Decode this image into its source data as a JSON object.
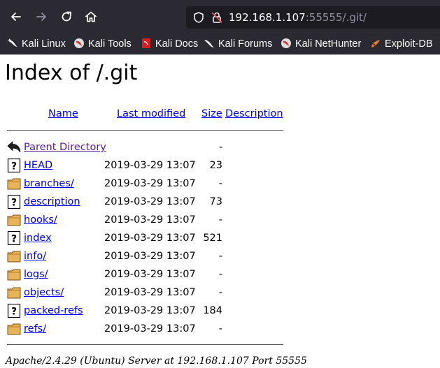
{
  "browser": {
    "url_host": "192.168.1.107",
    "url_rest": ":55555/.git/",
    "back_icon": "arrow-left-icon",
    "forward_icon": "arrow-right-icon",
    "reload_icon": "reload-icon",
    "home_icon": "home-icon"
  },
  "bookmarks": [
    {
      "label": "Kali Linux",
      "icon": "kali-dragon-icon"
    },
    {
      "label": "Kali Tools",
      "icon": "kali-tools-icon"
    },
    {
      "label": "Kali Docs",
      "icon": "kali-docs-icon"
    },
    {
      "label": "Kali Forums",
      "icon": "kali-forums-icon"
    },
    {
      "label": "Kali NetHunter",
      "icon": "kali-nethunter-icon"
    },
    {
      "label": "Exploit-DB",
      "icon": "exploit-db-icon"
    }
  ],
  "page": {
    "title": "Index of /.git",
    "headers": {
      "name": "Name",
      "last_modified": "Last modified",
      "size": "Size",
      "description": "Description"
    },
    "parent": {
      "name": "Parent Directory",
      "size": "-"
    },
    "entries": [
      {
        "name": "HEAD",
        "modified": "2019-03-29 13:07",
        "size": "23",
        "type": "file"
      },
      {
        "name": "branches/",
        "modified": "2019-03-29 13:07",
        "size": "-",
        "type": "folder"
      },
      {
        "name": "description",
        "modified": "2019-03-29 13:07",
        "size": "73",
        "type": "file"
      },
      {
        "name": "hooks/",
        "modified": "2019-03-29 13:07",
        "size": "-",
        "type": "folder"
      },
      {
        "name": "index",
        "modified": "2019-03-29 13:07",
        "size": "521",
        "type": "file"
      },
      {
        "name": "info/",
        "modified": "2019-03-29 13:07",
        "size": "-",
        "type": "folder"
      },
      {
        "name": "logs/",
        "modified": "2019-03-29 13:07",
        "size": "-",
        "type": "folder"
      },
      {
        "name": "objects/",
        "modified": "2019-03-29 13:07",
        "size": "-",
        "type": "folder"
      },
      {
        "name": "packed-refs",
        "modified": "2019-03-29 13:07",
        "size": "184",
        "type": "file"
      },
      {
        "name": "refs/",
        "modified": "2019-03-29 13:07",
        "size": "-",
        "type": "folder"
      }
    ],
    "footer": "Apache/2.4.29 (Ubuntu) Server at 192.168.1.107 Port 55555"
  }
}
